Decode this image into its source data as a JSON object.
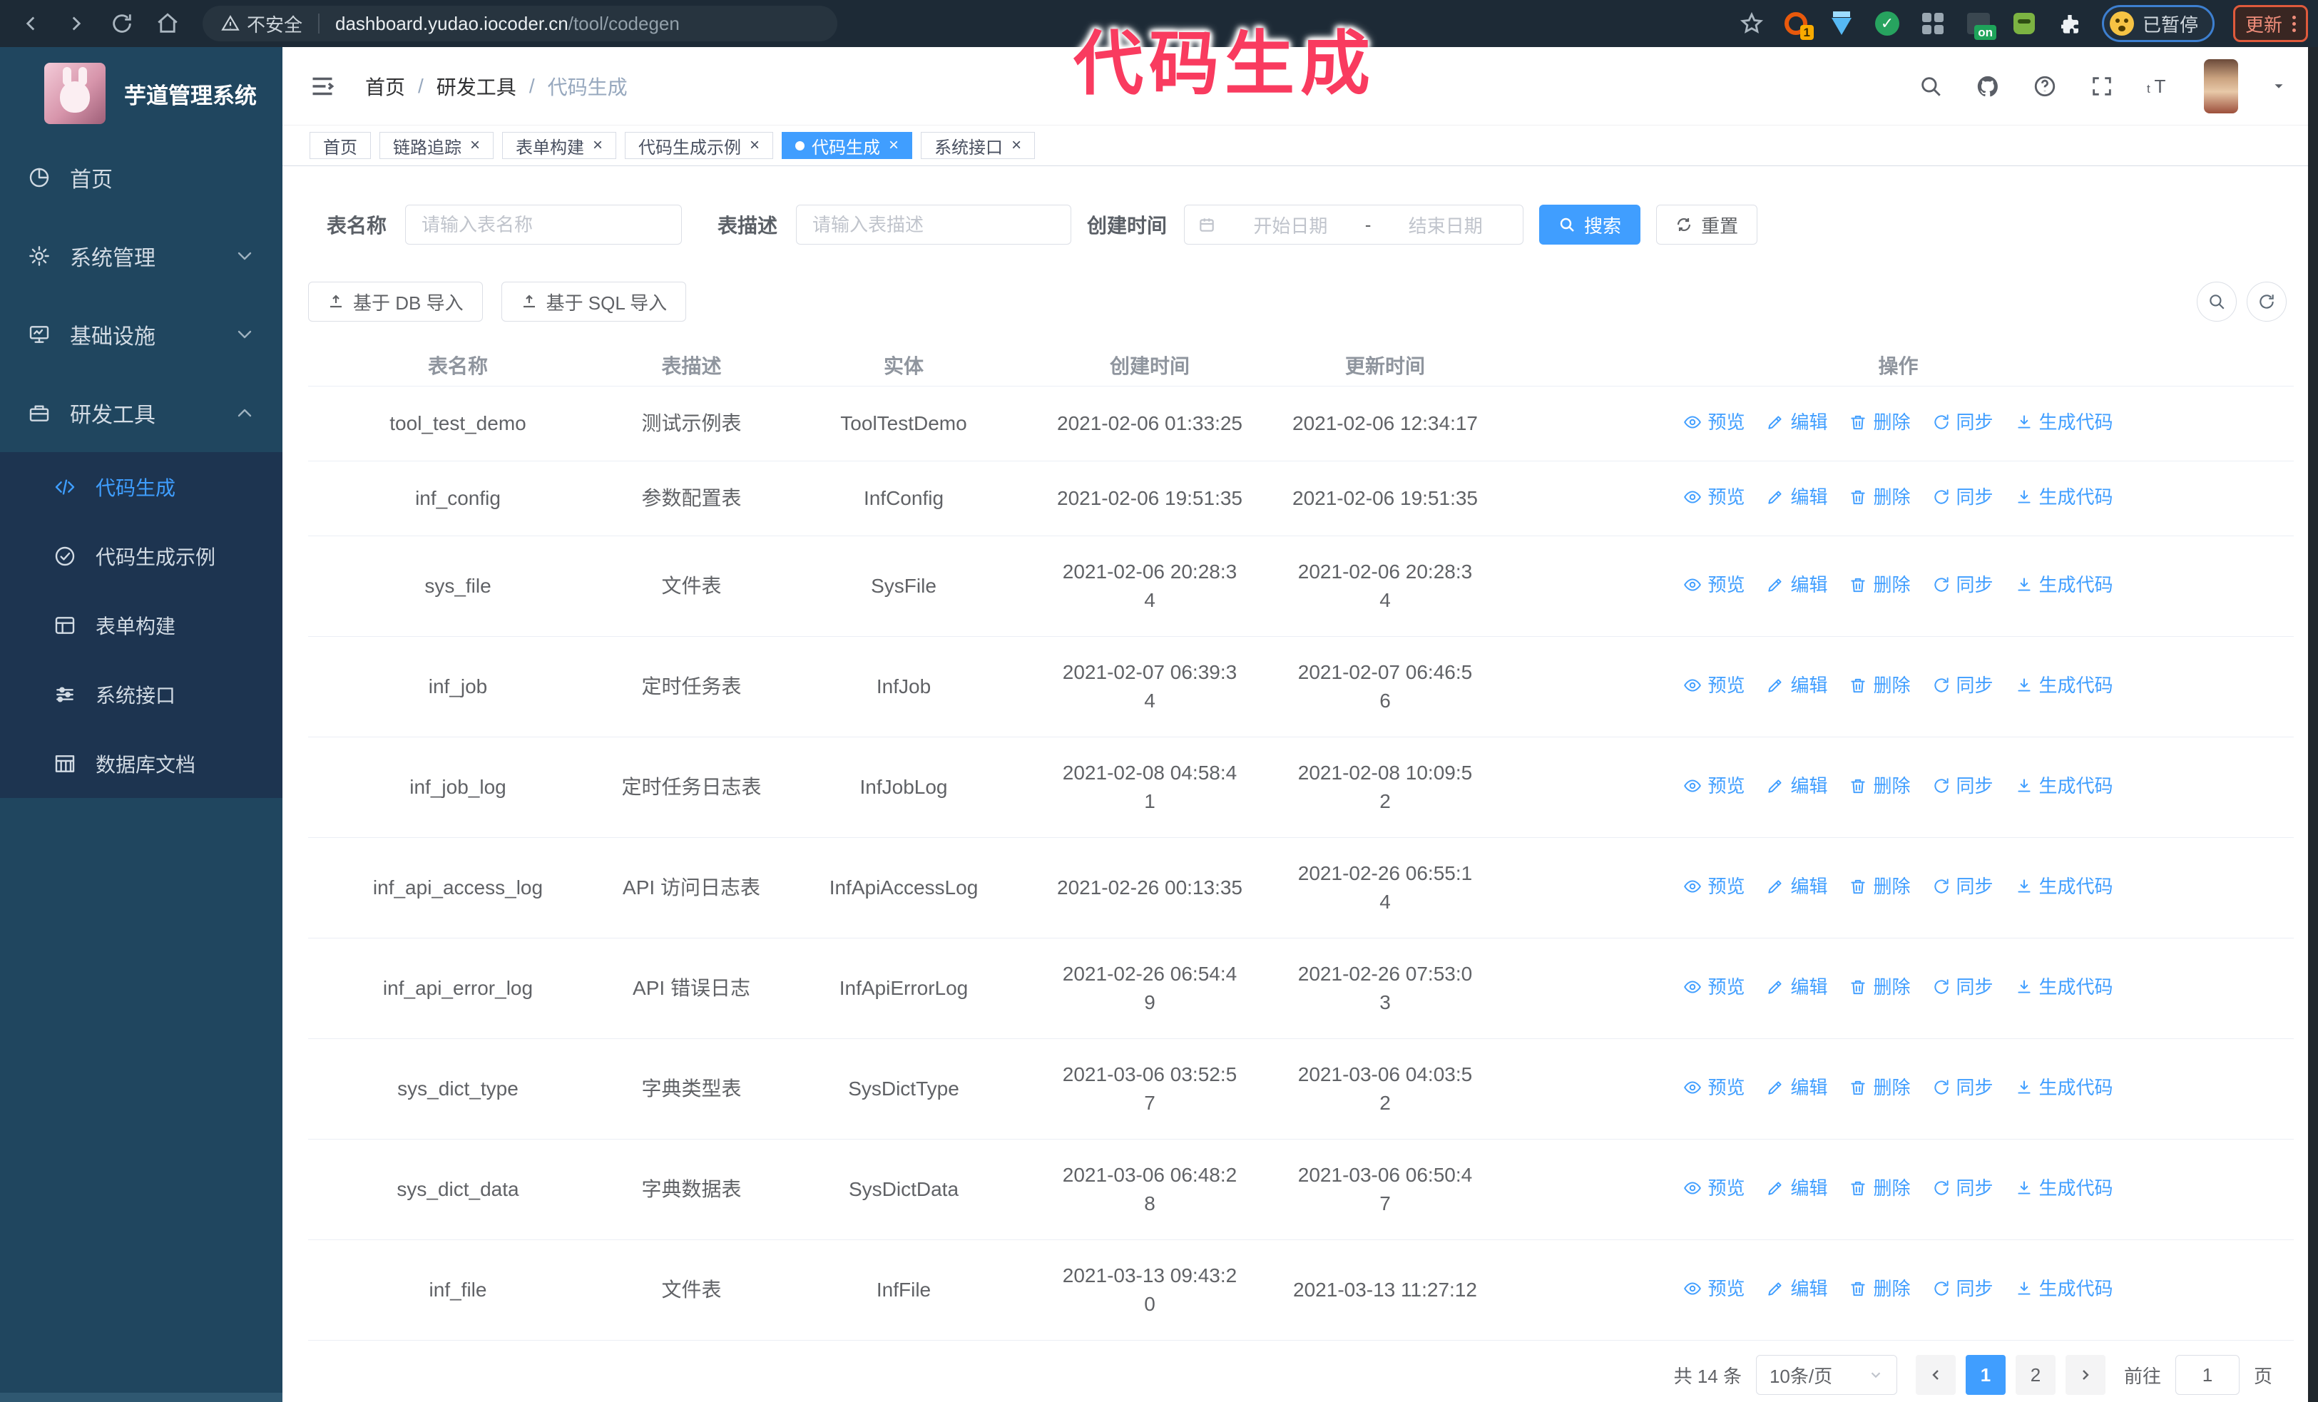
{
  "browser": {
    "security_label": "不安全",
    "url_domain": "dashboard.yudao.iocoder.cn",
    "url_path": "/tool/codegen",
    "extension_count_badge": "1",
    "extension_on_badge": "on",
    "paused_badge": "已暂停",
    "update_button": "更新"
  },
  "annotation": "代码生成",
  "sidebar": {
    "title": "芋道管理系统",
    "menu": [
      {
        "label": "首页",
        "icon": "dashboard-icon"
      },
      {
        "label": "系统管理",
        "icon": "gear-icon",
        "chevron": "down"
      },
      {
        "label": "基础设施",
        "icon": "infrastructure-icon",
        "chevron": "down"
      },
      {
        "label": "研发工具",
        "icon": "tools-icon",
        "chevron": "up",
        "open": true,
        "children": [
          {
            "label": "代码生成",
            "icon": "code-icon",
            "active": true
          },
          {
            "label": "代码生成示例",
            "icon": "example-check-icon"
          },
          {
            "label": "表单构建",
            "icon": "form-icon"
          },
          {
            "label": "系统接口",
            "icon": "sliders-icon"
          },
          {
            "label": "数据库文档",
            "icon": "db-doc-icon"
          }
        ]
      }
    ]
  },
  "header": {
    "breadcrumb": [
      "首页",
      "研发工具",
      "代码生成"
    ],
    "breadcrumb_separator": "/"
  },
  "tabs": [
    {
      "label": "首页",
      "closable": false,
      "active": false
    },
    {
      "label": "链路追踪",
      "closable": true,
      "active": false
    },
    {
      "label": "表单构建",
      "closable": true,
      "active": false
    },
    {
      "label": "代码生成示例",
      "closable": true,
      "active": false
    },
    {
      "label": "代码生成",
      "closable": true,
      "active": true
    },
    {
      "label": "系统接口",
      "closable": true,
      "active": false
    }
  ],
  "filters": {
    "table_name_label": "表名称",
    "table_name_placeholder": "请输入表名称",
    "table_desc_label": "表描述",
    "table_desc_placeholder": "请输入表描述",
    "create_time_label": "创建时间",
    "date_start_placeholder": "开始日期",
    "date_separator": "-",
    "date_end_placeholder": "结束日期",
    "search_label": "搜索",
    "reset_label": "重置"
  },
  "toolbar": {
    "import_db_label": "基于 DB 导入",
    "import_sql_label": "基于 SQL 导入"
  },
  "table": {
    "columns": [
      "表名称",
      "表描述",
      "实体",
      "创建时间",
      "更新时间",
      "操作"
    ],
    "row_actions": [
      {
        "label": "预览",
        "icon": "eye-icon",
        "name": "preview"
      },
      {
        "label": "编辑",
        "icon": "edit-icon",
        "name": "edit"
      },
      {
        "label": "删除",
        "icon": "delete-icon",
        "name": "delete"
      },
      {
        "label": "同步",
        "icon": "sync-icon",
        "name": "sync"
      },
      {
        "label": "生成代码",
        "icon": "download-icon",
        "name": "generate-code"
      }
    ],
    "rows": [
      {
        "name": "tool_test_demo",
        "desc": "测试示例表",
        "entity": "ToolTestDemo",
        "created": "2021-02-06 01:33:25",
        "updated": "2021-02-06 12:34:17"
      },
      {
        "name": "inf_config",
        "desc": "参数配置表",
        "entity": "InfConfig",
        "created": "2021-02-06 19:51:35",
        "updated": "2021-02-06 19:51:35"
      },
      {
        "name": "sys_file",
        "desc": "文件表",
        "entity": "SysFile",
        "created": "2021-02-06 20:28:3\n4",
        "updated": "2021-02-06 20:28:3\n4"
      },
      {
        "name": "inf_job",
        "desc": "定时任务表",
        "entity": "InfJob",
        "created": "2021-02-07 06:39:3\n4",
        "updated": "2021-02-07 06:46:5\n6"
      },
      {
        "name": "inf_job_log",
        "desc": "定时任务日志表",
        "entity": "InfJobLog",
        "created": "2021-02-08 04:58:4\n1",
        "updated": "2021-02-08 10:09:5\n2"
      },
      {
        "name": "inf_api_access_log",
        "desc": "API 访问日志表",
        "entity": "InfApiAccessLog",
        "created": "2021-02-26 00:13:35",
        "updated": "2021-02-26 06:55:1\n4"
      },
      {
        "name": "inf_api_error_log",
        "desc": "API 错误日志",
        "entity": "InfApiErrorLog",
        "created": "2021-02-26 06:54:4\n9",
        "updated": "2021-02-26 07:53:0\n3"
      },
      {
        "name": "sys_dict_type",
        "desc": "字典类型表",
        "entity": "SysDictType",
        "created": "2021-03-06 03:52:5\n7",
        "updated": "2021-03-06 04:03:5\n2"
      },
      {
        "name": "sys_dict_data",
        "desc": "字典数据表",
        "entity": "SysDictData",
        "created": "2021-03-06 06:48:2\n8",
        "updated": "2021-03-06 06:50:4\n7"
      },
      {
        "name": "inf_file",
        "desc": "文件表",
        "entity": "InfFile",
        "created": "2021-03-13 09:43:2\n0",
        "updated": "2021-03-13 11:27:12"
      }
    ]
  },
  "pagination": {
    "total_label": "共 14 条",
    "page_size_label": "10条/页",
    "pages": [
      {
        "label": "1",
        "active": true
      },
      {
        "label": "2",
        "active": false
      }
    ],
    "goto_label": "前往",
    "goto_value": "1",
    "page_suffix": "页"
  }
}
